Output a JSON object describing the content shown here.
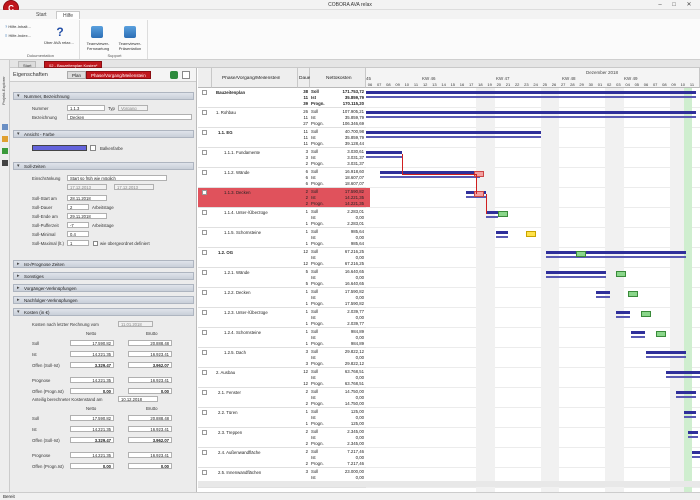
{
  "app": {
    "title": "COBORA AVA relax",
    "logo_letter": "C"
  },
  "ribbon": {
    "tabs": [
      "Start",
      "Hilfe"
    ],
    "active_tab": "Hilfe",
    "help_group": {
      "items": [
        "Hilfe-Inhalt...",
        "Hilfe-Index..."
      ],
      "about": "Über AVA relax...",
      "label": "Dokumentation"
    },
    "support_group": {
      "items": [
        "Teamviewer-Fernwartung",
        "Teamviewer-Präsentation"
      ],
      "label": "Support"
    }
  },
  "side_tabs": [
    "Projekt-Explorer"
  ],
  "doc_tabs": {
    "start": "Start",
    "active": "02 - Bauzeitenplan Kosten*"
  },
  "props": {
    "title": "Eigenschaften",
    "mode_tabs": [
      "Plan",
      "Phase/Vorgang/Meilenstein"
    ],
    "sections": {
      "nummer": "Nummer, Bezeichnung",
      "ansicht": "Ansicht - Farbe",
      "soll": "Soll-Zeiten",
      "ist": "Ist-/Prognose Zeiten",
      "sonstiges": "Sonstiges",
      "vorganger": "Vorgänger-Verknüpfungen",
      "nachfolger": "Nachfolger-Verknüpfungen",
      "kosten": "Kosten (in €)"
    },
    "nummer_label": "Nummer",
    "nummer_value": "1.1.3",
    "typ_label": "Typ",
    "typ_value": "Vorgang",
    "bez_label": "Bezeichnung",
    "bez_value": "Decken",
    "balken_label": "Balkenfarbe",
    "einschraenkung_label": "Einschränkung",
    "einschraenkung_value": "Start so früh wie möglich",
    "einschr_date1": "17.12.2013",
    "einschr_date2": "17.12.2013",
    "sollstart_label": "Soll-Start am",
    "sollstart_value": "28.11.2018",
    "solldauer_label": "Soll-Dauer",
    "solldauer_value": "2",
    "solldauer_unit": "Arbeitstage",
    "sollende_label": "Soll-Ende am",
    "sollende_value": "29.11.2018",
    "puffer_label": "Soll-Pufferzeit",
    "puffer_value": "-7",
    "puffer_unit": "Arbeitstage",
    "minimal_label": "Soll-Minimal",
    "minimal_value": "0,4",
    "maximal_label": "Soll-Maximal (lt.)",
    "maximal_value": "1",
    "maximal_check": "wie übergeordnet definiert",
    "kosten": {
      "head1": "Kosten nach letzter Rechnung vom",
      "date1": "11.01.2018",
      "col_netto": "Netto",
      "col_brutto": "Brutto",
      "rows1": [
        {
          "label": "Soll",
          "netto": "17.590,82",
          "brutto": "20.888,48"
        },
        {
          "label": "Ist",
          "netto": "14.221,35",
          "brutto": "16.923,41"
        },
        {
          "label": "Offen (Soll-Ist)",
          "netto": "3.329,47",
          "brutto": "3.962,07"
        },
        {
          "label": "Prognose",
          "netto": "14.221,35",
          "brutto": "16.923,41"
        },
        {
          "label": "Offen (Progn.Ist)",
          "netto": "0,00",
          "brutto": "0,00"
        }
      ],
      "head2": "Anteilig berechneter Kostenstand am",
      "date2": "10.12.2018",
      "rows2": [
        {
          "label": "Soll",
          "netto": "17.590,82",
          "brutto": "20.888,48"
        },
        {
          "label": "Ist",
          "netto": "14.221,35",
          "brutto": "16.923,41"
        },
        {
          "label": "Offen (Soll-Ist)",
          "netto": "3.329,47",
          "brutto": "3.962,07"
        },
        {
          "label": "Prognose",
          "netto": "14.221,35",
          "brutto": "16.923,41"
        },
        {
          "label": "Offen (Progn.Ist)",
          "netto": "0,00",
          "brutto": "0,00"
        }
      ]
    }
  },
  "grid": {
    "headers": {
      "phase": "Phase/Vorgang/Meilenstein",
      "dauer": "Dauer",
      "netto": "Nettokosten"
    },
    "month_label": "Dezember 2018",
    "kw": [
      "45",
      "KW 46",
      "KW 47",
      "KW 48",
      "KW 49"
    ],
    "days": [
      "06",
      "07",
      "08",
      "09",
      "10",
      "11",
      "12",
      "13",
      "14",
      "15",
      "16",
      "17",
      "18",
      "19",
      "20",
      "21",
      "22",
      "23",
      "24",
      "25",
      "26",
      "27",
      "28",
      "29",
      "30",
      "01",
      "02",
      "03",
      "04",
      "05",
      "06",
      "07",
      "08",
      "09",
      "10",
      "11"
    ],
    "rows": [
      {
        "name": "Bauzeitenplan",
        "bold": true,
        "lines": [
          [
            "38",
            "Soll",
            "171.753,72"
          ],
          [
            "11",
            "Ist",
            "35.859,79"
          ],
          [
            "39",
            "Progn.",
            "170.115,20"
          ]
        ]
      },
      {
        "name": "1. Rohbau",
        "bold": false,
        "lines": [
          [
            "26",
            "Soll",
            "107.905,21"
          ],
          [
            "11",
            "Ist",
            "35.859,79"
          ],
          [
            "27",
            "Progn.",
            "106.346,69"
          ]
        ]
      },
      {
        "name": "1.1. EG",
        "bold": true,
        "lines": [
          [
            "11",
            "Soll",
            "40.700,98"
          ],
          [
            "11",
            "Ist",
            "35.859,79"
          ],
          [
            "11",
            "Progn.",
            "39.128,44"
          ]
        ]
      },
      {
        "name": "1.1.1. Fundamente",
        "bold": false,
        "lines": [
          [
            "3",
            "Soll",
            "3.030,61"
          ],
          [
            "3",
            "Ist",
            "3.031,37"
          ],
          [
            "2",
            "Progn.",
            "3.031,37"
          ]
        ]
      },
      {
        "name": "1.1.2. Wände",
        "bold": false,
        "lines": [
          [
            "6",
            "Soll",
            "16.918,60"
          ],
          [
            "6",
            "Ist",
            "18.607,07"
          ],
          [
            "6",
            "Progn.",
            "18.607,07"
          ]
        ]
      },
      {
        "name": "1.1.3. Decken",
        "bold": false,
        "sel": true,
        "lines": [
          [
            "2",
            "Soll",
            "17.590,82"
          ],
          [
            "2",
            "Ist",
            "14.221,35"
          ],
          [
            "2",
            "Progn.",
            "14.221,35"
          ]
        ]
      },
      {
        "name": "1.1.4. Unter-/Überzüge",
        "bold": false,
        "lines": [
          [
            "1",
            "Soll",
            "2.283,01"
          ],
          [
            "",
            "Ist",
            "0,00"
          ],
          [
            "1",
            "Progn.",
            "2.283,01"
          ]
        ]
      },
      {
        "name": "1.1.5. Schornsteine",
        "bold": false,
        "lines": [
          [
            "1",
            "Soll",
            "985,64"
          ],
          [
            "",
            "Ist",
            "0,00"
          ],
          [
            "1",
            "Progn.",
            "985,64"
          ]
        ]
      },
      {
        "name": "1.2. OG",
        "bold": true,
        "lines": [
          [
            "12",
            "Soll",
            "67.216,25"
          ],
          [
            "",
            "Ist",
            "0,00"
          ],
          [
            "12",
            "Progn.",
            "67.216,25"
          ]
        ]
      },
      {
        "name": "1.2.1. Wände",
        "bold": false,
        "lines": [
          [
            "5",
            "Soll",
            "16.640,65"
          ],
          [
            "",
            "Ist",
            "0,00"
          ],
          [
            "5",
            "Progn.",
            "16.640,65"
          ]
        ]
      },
      {
        "name": "1.2.2. Decken",
        "bold": false,
        "lines": [
          [
            "1",
            "Soll",
            "17.590,82"
          ],
          [
            "",
            "Ist",
            "0,00"
          ],
          [
            "1",
            "Progn.",
            "17.590,82"
          ]
        ]
      },
      {
        "name": "1.2.3. Unter-/Überzüge",
        "bold": false,
        "lines": [
          [
            "1",
            "Soll",
            "2.039,77"
          ],
          [
            "",
            "Ist",
            "0,00"
          ],
          [
            "1",
            "Progn.",
            "2.039,77"
          ]
        ]
      },
      {
        "name": "1.2.4. Schornsteine",
        "bold": false,
        "lines": [
          [
            "1",
            "Soll",
            "984,89"
          ],
          [
            "",
            "Ist",
            "0,00"
          ],
          [
            "1",
            "Progn.",
            "984,89"
          ]
        ]
      },
      {
        "name": "1.2.5. Dach",
        "bold": false,
        "lines": [
          [
            "3",
            "Soll",
            "29.822,12"
          ],
          [
            "",
            "Ist",
            "0,00"
          ],
          [
            "3",
            "Progn.",
            "29.822,12"
          ]
        ]
      },
      {
        "name": "2. Ausbau",
        "bold": false,
        "lines": [
          [
            "12",
            "Soll",
            "63.768,51"
          ],
          [
            "",
            "Ist",
            "0,00"
          ],
          [
            "12",
            "Progn.",
            "63.768,51"
          ]
        ]
      },
      {
        "name": "2.1. Fenster",
        "bold": false,
        "lines": [
          [
            "2",
            "Soll",
            "14.750,00"
          ],
          [
            "",
            "Ist",
            "0,00"
          ],
          [
            "2",
            "Progn.",
            "14.750,00"
          ]
        ]
      },
      {
        "name": "2.2. Türen",
        "bold": false,
        "lines": [
          [
            "1",
            "Soll",
            "125,00"
          ],
          [
            "",
            "Ist",
            "0,00"
          ],
          [
            "1",
            "Progn.",
            "125,00"
          ]
        ]
      },
      {
        "name": "2.3. Treppen",
        "bold": false,
        "lines": [
          [
            "2",
            "Soll",
            "2.345,00"
          ],
          [
            "",
            "Ist",
            "0,00"
          ],
          [
            "2",
            "Progn.",
            "2.345,00"
          ]
        ]
      },
      {
        "name": "2.4. Außenwandfläche",
        "bold": false,
        "lines": [
          [
            "2",
            "Soll",
            "7.217,46"
          ],
          [
            "",
            "Ist",
            "0,00"
          ],
          [
            "2",
            "Progn.",
            "7.217,46"
          ]
        ]
      },
      {
        "name": "2.5. Innenwandflächen",
        "bold": false,
        "lines": [
          [
            "3",
            "Soll",
            "23.000,00"
          ],
          [
            "",
            "Ist",
            "0,00"
          ],
          [
            "3",
            "Progn.",
            "23.000,00"
          ]
        ]
      }
    ]
  },
  "status": {
    "text": "Bereit"
  },
  "colors": {
    "accent": "#c0161c",
    "selected_row": "#e0525c",
    "bar": "#2f2f9a"
  }
}
